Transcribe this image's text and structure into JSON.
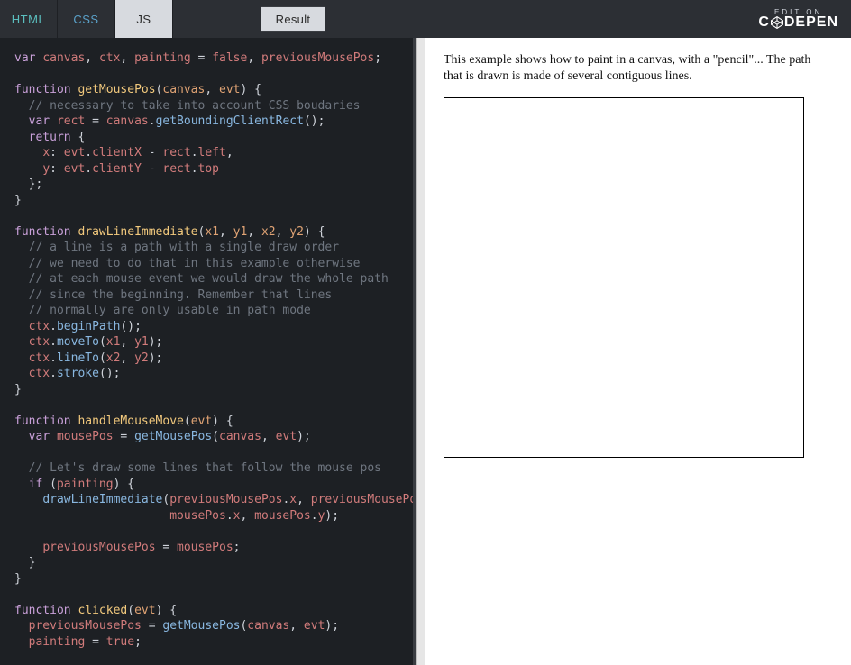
{
  "topbar": {
    "tabs": {
      "html": "HTML",
      "css": "CSS",
      "js": "JS"
    },
    "result_label": "Result",
    "brand": {
      "edit_on": "EDIT ON",
      "name_left": "C",
      "name_right": "DEPEN"
    }
  },
  "editor": {
    "code_html": "<span class=\"kw\">var</span> <span class=\"id\">canvas</span><span class=\"punc\">,</span> <span class=\"id\">ctx</span><span class=\"punc\">,</span> <span class=\"id\">painting</span> <span class=\"punc\">=</span> <span class=\"lit\">false</span><span class=\"punc\">,</span> <span class=\"id\">previousMousePos</span><span class=\"punc\">;</span>\n\n<span class=\"kw\">function</span> <span class=\"fn\">getMousePos</span><span class=\"punc\">(</span><span class=\"arg\">canvas</span><span class=\"punc\">,</span> <span class=\"arg\">evt</span><span class=\"punc\">) {</span>\n  <span class=\"cmt\">// necessary to take into account CSS boudaries</span>\n  <span class=\"kw\">var</span> <span class=\"id\">rect</span> <span class=\"punc\">=</span> <span class=\"id\">canvas</span><span class=\"punc\">.</span><span class=\"call\">getBoundingClientRect</span><span class=\"punc\">();</span>\n  <span class=\"kw\">return</span> <span class=\"punc\">{</span>\n    <span class=\"id\">x</span><span class=\"punc\">:</span> <span class=\"id\">evt</span><span class=\"punc\">.</span><span class=\"id\">clientX</span> <span class=\"punc\">-</span> <span class=\"id\">rect</span><span class=\"punc\">.</span><span class=\"id\">left</span><span class=\"punc\">,</span>\n    <span class=\"id\">y</span><span class=\"punc\">:</span> <span class=\"id\">evt</span><span class=\"punc\">.</span><span class=\"id\">clientY</span> <span class=\"punc\">-</span> <span class=\"id\">rect</span><span class=\"punc\">.</span><span class=\"id\">top</span>\n  <span class=\"punc\">};</span>\n<span class=\"punc\">}</span>\n\n<span class=\"kw\">function</span> <span class=\"fn\">drawLineImmediate</span><span class=\"punc\">(</span><span class=\"arg\">x1</span><span class=\"punc\">,</span> <span class=\"arg\">y1</span><span class=\"punc\">,</span> <span class=\"arg\">x2</span><span class=\"punc\">,</span> <span class=\"arg\">y2</span><span class=\"punc\">) {</span>\n  <span class=\"cmt\">// a line is a path with a single draw order</span>\n  <span class=\"cmt\">// we need to do that in this example otherwise</span>\n  <span class=\"cmt\">// at each mouse event we would draw the whole path</span>\n  <span class=\"cmt\">// since the beginning. Remember that lines</span>\n  <span class=\"cmt\">// normally are only usable in path mode</span>\n  <span class=\"id\">ctx</span><span class=\"punc\">.</span><span class=\"call\">beginPath</span><span class=\"punc\">();</span>\n  <span class=\"id\">ctx</span><span class=\"punc\">.</span><span class=\"call\">moveTo</span><span class=\"punc\">(</span><span class=\"id\">x1</span><span class=\"punc\">,</span> <span class=\"id\">y1</span><span class=\"punc\">);</span>\n  <span class=\"id\">ctx</span><span class=\"punc\">.</span><span class=\"call\">lineTo</span><span class=\"punc\">(</span><span class=\"id\">x2</span><span class=\"punc\">,</span> <span class=\"id\">y2</span><span class=\"punc\">);</span>\n  <span class=\"id\">ctx</span><span class=\"punc\">.</span><span class=\"call\">stroke</span><span class=\"punc\">();</span>\n<span class=\"punc\">}</span>\n\n<span class=\"kw\">function</span> <span class=\"fn\">handleMouseMove</span><span class=\"punc\">(</span><span class=\"arg\">evt</span><span class=\"punc\">) {</span>\n  <span class=\"kw\">var</span> <span class=\"id\">mousePos</span> <span class=\"punc\">=</span> <span class=\"call\">getMousePos</span><span class=\"punc\">(</span><span class=\"id\">canvas</span><span class=\"punc\">,</span> <span class=\"id\">evt</span><span class=\"punc\">);</span>\n\n  <span class=\"cmt\">// Let's draw some lines that follow the mouse pos</span>\n  <span class=\"kw\">if</span> <span class=\"punc\">(</span><span class=\"id\">painting</span><span class=\"punc\">) {</span>\n    <span class=\"call\">drawLineImmediate</span><span class=\"punc\">(</span><span class=\"id\">previousMousePos</span><span class=\"punc\">.</span><span class=\"id\">x</span><span class=\"punc\">,</span> <span class=\"id\">previousMousePos</span><span class=\"punc\">.</span><span class=\"id\">y</span><span class=\"punc\">,</span>\n                      <span class=\"id\">mousePos</span><span class=\"punc\">.</span><span class=\"id\">x</span><span class=\"punc\">,</span> <span class=\"id\">mousePos</span><span class=\"punc\">.</span><span class=\"id\">y</span><span class=\"punc\">);</span>\n\n    <span class=\"id\">previousMousePos</span> <span class=\"punc\">=</span> <span class=\"id\">mousePos</span><span class=\"punc\">;</span>\n  <span class=\"punc\">}</span>\n<span class=\"punc\">}</span>\n\n<span class=\"kw\">function</span> <span class=\"fn\">clicked</span><span class=\"punc\">(</span><span class=\"arg\">evt</span><span class=\"punc\">) {</span>\n  <span class=\"id\">previousMousePos</span> <span class=\"punc\">=</span> <span class=\"call\">getMousePos</span><span class=\"punc\">(</span><span class=\"id\">canvas</span><span class=\"punc\">,</span> <span class=\"id\">evt</span><span class=\"punc\">);</span>\n  <span class=\"id\">painting</span> <span class=\"punc\">=</span> <span class=\"lit\">true</span><span class=\"punc\">;</span>"
  },
  "result": {
    "description": "This example shows how to paint in a canvas, with a \"pencil\"... The path that is drawn is made of several contiguous lines."
  }
}
